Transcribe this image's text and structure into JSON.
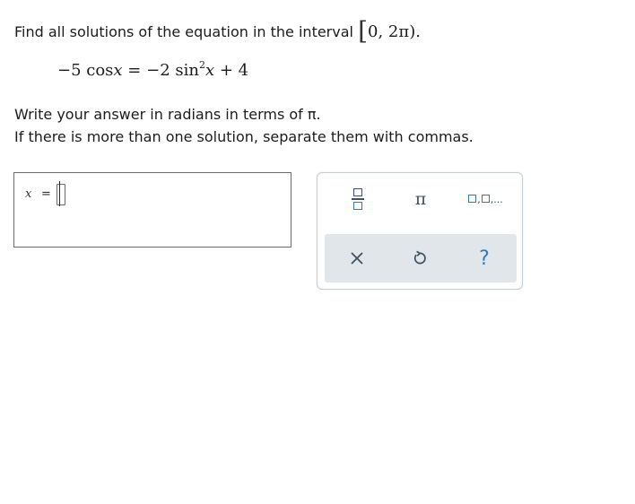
{
  "question": {
    "prompt": "Find all solutions of the equation in the interval ",
    "interval_open": "[",
    "interval_body": "0, 2π",
    "interval_close": ")",
    "interval_end": "."
  },
  "equation": {
    "lhs": "−5 cos",
    "lhs_var": "x",
    "eq": " = ",
    "rhs_start": "−2 sin",
    "rhs_exp": "2",
    "rhs_var": "x",
    "rhs_end": " + 4"
  },
  "instructions": {
    "line1": "Write your answer in radians in terms of π.",
    "line2": "If there is more than one solution, separate them with commas."
  },
  "answer": {
    "variable": "x",
    "equals": "="
  },
  "keypad": {
    "pi": "π",
    "list_sep1": ",",
    "list_sep2": ",...",
    "help": "?",
    "icons": {
      "fraction": "fraction-icon",
      "pi": "pi-icon",
      "list": "list-icon",
      "clear": "close-icon",
      "undo": "undo-icon",
      "help": "help-icon"
    },
    "colors": {
      "icon_dark": "#3d4f63",
      "icon_blue": "#2b7bbf",
      "action_bar": "#e1e6ea",
      "border": "#c4ccd4"
    }
  }
}
